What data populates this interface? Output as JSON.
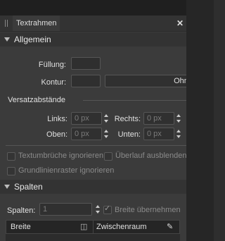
{
  "panel": {
    "tab_label": "Textrahmen",
    "close_glyph": "✕"
  },
  "allgemein": {
    "title": "Allgemein",
    "fill_label": "Füllung:",
    "stroke_label": "Kontur:",
    "stroke_style_value": "Ohne"
  },
  "insets": {
    "title": "Versatzabstände",
    "left_label": "Links:",
    "left_value": "0 px",
    "right_label": "Rechts:",
    "right_value": "0 px",
    "top_label": "Oben:",
    "top_value": "0 px",
    "bottom_label": "Unten:",
    "bottom_value": "0 px"
  },
  "options": {
    "ignore_wrap_label": "Textumbrüche ignorieren",
    "ignore_wrap_checked": false,
    "hide_overflow_label": "Überlauf ausblenden",
    "hide_overflow_checked": false,
    "ignore_baseline_label": "Grundlinienraster ignorieren",
    "ignore_baseline_checked": false
  },
  "columns": {
    "title": "Spalten",
    "count_label": "Spalten:",
    "count_value": "1",
    "inherit_width_label": "Breite übernehmen",
    "inherit_width_checked": true,
    "col_header_width": "Breite",
    "col_header_gutter": "Zwischenraum"
  },
  "colors": {
    "panel_bg": "#3b3b3b",
    "section_bg": "#333333",
    "field_bg": "#303030",
    "text": "#e0e0e0",
    "disabled_text": "#8a8a8a"
  }
}
